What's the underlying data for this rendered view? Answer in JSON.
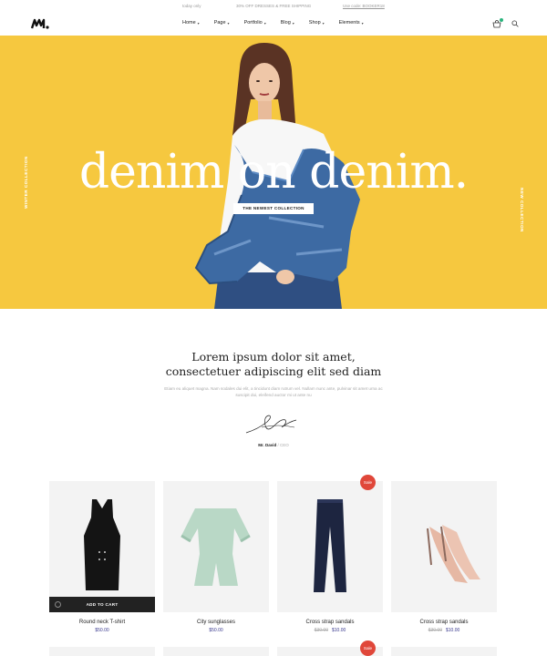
{
  "topbar": {
    "left": "today only",
    "center": "30% OFF DRESSES & FREE SHIPPING",
    "right": "Use code: BOOKER18"
  },
  "nav": {
    "items": [
      {
        "label": "Home"
      },
      {
        "label": "Page"
      },
      {
        "label": "Portfolio"
      },
      {
        "label": "Blog"
      },
      {
        "label": "Shop"
      },
      {
        "label": "Elements"
      }
    ],
    "icons": [
      "cart-icon",
      "search-icon"
    ]
  },
  "hero": {
    "background": "#f6c83f",
    "headline": "denim on denim.",
    "cta": "THE NEWEST COLLECTION",
    "side_left": "WINTER COLLECTION",
    "side_right": "NEW COLLECTION"
  },
  "about": {
    "title_line1": "Lorem ipsum dolor sit amet,",
    "title_line2": "consectetuer adipiscing elit sed diam",
    "body": "Etiam eu aliquet magna. Nam sodales dui elit, a tincidunt diam rutrum vel. Nullam nunc ante, pulvinar sit amet urna ac suscipit dui, eleifend auctor mi ut ante nu",
    "author_name": "Mr. David",
    "author_role": "/ CEO"
  },
  "products": [
    {
      "name": "Round neck T-shirt",
      "price": "$50.00",
      "old_price": "",
      "sale": false,
      "hover_label": "ADD TO CART"
    },
    {
      "name": "City sunglasses",
      "price": "$50.00",
      "old_price": "",
      "sale": false
    },
    {
      "name": "Cross strap sandals",
      "price": "$10.00",
      "old_price": "$30.00",
      "sale": true
    },
    {
      "name": "Cross strap sandals",
      "price": "$10.00",
      "old_price": "$30.00",
      "sale": false
    }
  ],
  "sale_label": "Sale",
  "colors": {
    "accent": "#f6c83f",
    "sale": "#e0473a",
    "price": "#3a3a8e",
    "cart_dot": "#28b47c"
  }
}
